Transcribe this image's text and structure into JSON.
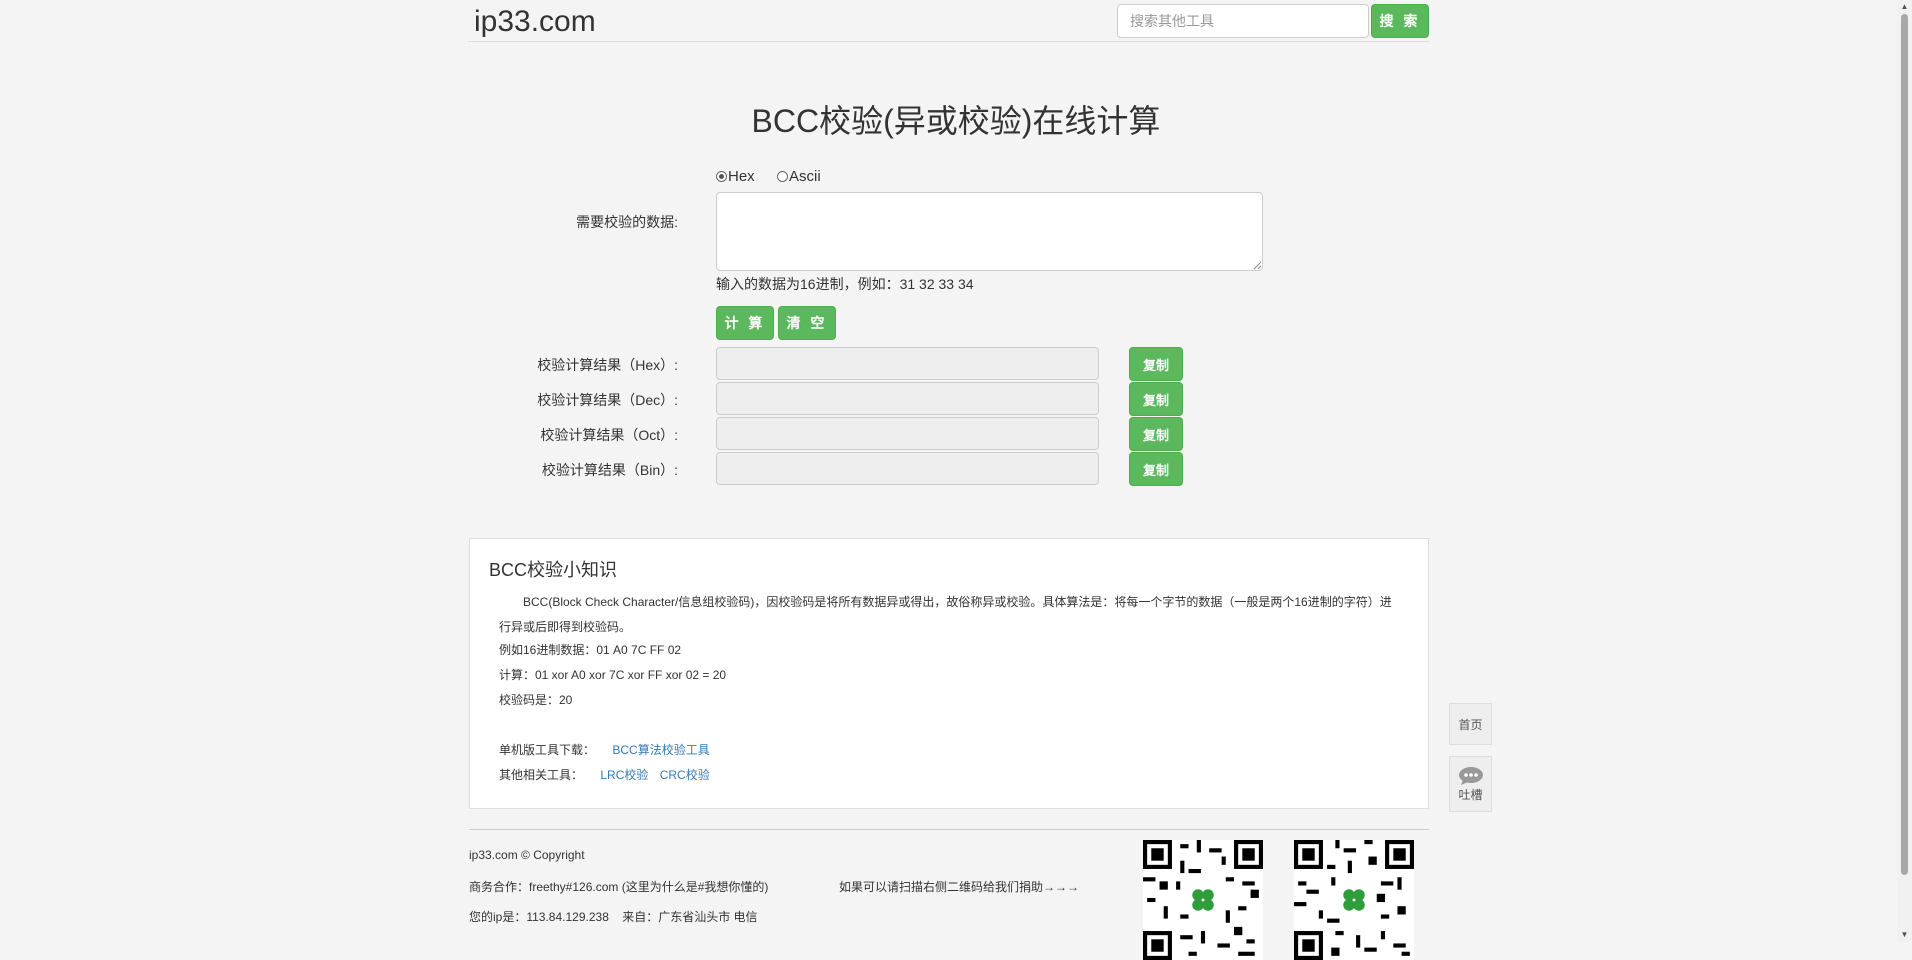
{
  "header": {
    "logo": "ip33.com",
    "search_placeholder": "搜索其他工具",
    "search_button": "搜 索"
  },
  "title": "BCC校验(异或校验)在线计算",
  "form": {
    "radio_hex": "Hex",
    "radio_ascii": "Ascii",
    "data_label": "需要校验的数据:",
    "hint": "输入的数据为16进制，例如：31 32 33 34",
    "calc_button": "计 算",
    "clear_button": "清 空",
    "results": [
      {
        "label": "校验计算结果（Hex）:",
        "copy": "复制"
      },
      {
        "label": "校验计算结果（Dec）:",
        "copy": "复制"
      },
      {
        "label": "校验计算结果（Oct）:",
        "copy": "复制"
      },
      {
        "label": "校验计算结果（Bin）:",
        "copy": "复制"
      }
    ]
  },
  "knowledge": {
    "title": "BCC校验小知识",
    "intro": "BCC(Block Check Character/信息组校验码)，因校验码是将所有数据异或得出，故俗称异或校验。具体算法是：将每一个字节的数据（一般是两个16进制的字符）进行异或后即得到校验码。",
    "example": "例如16进制数据：01 A0 7C FF 02",
    "calc": "计算：01 xor A0 xor 7C xor FF xor 02 = 20",
    "result": "校验码是：20",
    "download_label": "单机版工具下载：",
    "download_link": "BCC算法校验工具",
    "related_label": "其他相关工具：",
    "related_links": [
      "LRC校验",
      "CRC校验"
    ]
  },
  "side": {
    "home": "首页",
    "feedback": "吐槽"
  },
  "footer": {
    "copyright": "ip33.com © Copyright",
    "business": "商务合作：freethy#126.com (这里为什么是#我想你懂的)",
    "donate": "如果可以请扫描右侧二维码给我们捐助→→→",
    "ip": "您的ip是：113.84.129.238    来自：广东省汕头市 电信"
  },
  "colors": {
    "accent_green": "#5cb85c",
    "link_blue": "#337ab7"
  }
}
